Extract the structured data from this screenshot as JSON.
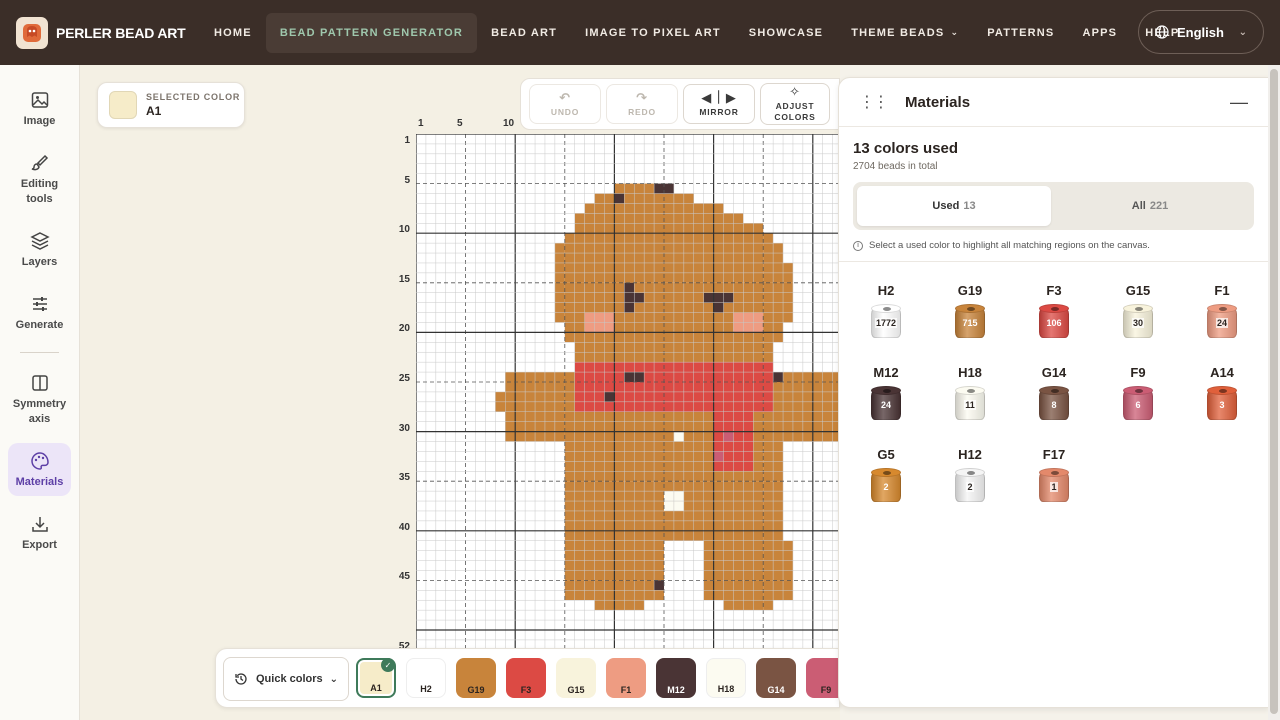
{
  "app": {
    "name": "PERLER BEAD ART"
  },
  "nav": {
    "items": [
      {
        "label": "HOME",
        "active": false
      },
      {
        "label": "BEAD PATTERN GENERATOR",
        "active": true
      },
      {
        "label": "BEAD ART",
        "active": false
      },
      {
        "label": "IMAGE TO PIXEL ART",
        "active": false
      },
      {
        "label": "SHOWCASE",
        "active": false
      },
      {
        "label": "THEME BEADS",
        "active": false,
        "dropdown": true
      },
      {
        "label": "PATTERNS",
        "active": false
      },
      {
        "label": "APPS",
        "active": false
      },
      {
        "label": "HELP",
        "active": false
      }
    ],
    "language": "English"
  },
  "sidebar": {
    "items": [
      {
        "label": "Image",
        "icon": "image-icon"
      },
      {
        "label": "Editing tools",
        "icon": "brush-icon"
      },
      {
        "label": "Layers",
        "icon": "layers-icon"
      },
      {
        "label": "Generate",
        "icon": "sliders-icon"
      },
      {
        "label": "Symmetry axis",
        "icon": "symmetry-icon"
      },
      {
        "label": "Materials",
        "icon": "palette-icon",
        "active": true
      },
      {
        "label": "Export",
        "icon": "download-icon"
      }
    ]
  },
  "selected_color": {
    "caption": "SELECTED COLOR",
    "value": "A1",
    "hex": "#f6ecc9"
  },
  "toolbar": {
    "undo": "UNDO",
    "redo": "REDO",
    "mirror": "MIRROR",
    "adjust": "ADJUST COLORS"
  },
  "rulers": {
    "top": [
      "1",
      "5",
      "10"
    ],
    "left": [
      "1",
      "5",
      "10",
      "15",
      "20",
      "25",
      "30",
      "35",
      "40",
      "45",
      "52"
    ]
  },
  "quick_colors": {
    "label": "Quick colors",
    "swatches": [
      {
        "code": "A1",
        "hex": "#f6ecc9",
        "text": "#2b2420",
        "selected": true
      },
      {
        "code": "H2",
        "hex": "#ffffff",
        "text": "#2b2420"
      },
      {
        "code": "G19",
        "hex": "#c8843b",
        "text": "#2b2420"
      },
      {
        "code": "F3",
        "hex": "#dc4a44",
        "text": "#2b2420"
      },
      {
        "code": "G15",
        "hex": "#f8f3dc",
        "text": "#2b2420"
      },
      {
        "code": "F1",
        "hex": "#ee9c82",
        "text": "#2b2420"
      },
      {
        "code": "M12",
        "hex": "#4a3435",
        "text": "#ffffff"
      },
      {
        "code": "H18",
        "hex": "#fcfbf1",
        "text": "#2b2420"
      },
      {
        "code": "G14",
        "hex": "#7a5443",
        "text": "#ffffff"
      },
      {
        "code": "F9",
        "hex": "#cb5d74",
        "text": "#2b2420"
      }
    ]
  },
  "materials": {
    "title": "Materials",
    "colors_used": "13 colors used",
    "beads_total": "2704 beads in total",
    "tabs": [
      {
        "label": "Used",
        "count": "13",
        "active": true
      },
      {
        "label": "All",
        "count": "221",
        "active": false
      }
    ],
    "hint": "Select a used color to highlight all matching regions on the canvas.",
    "items": [
      {
        "code": "H2",
        "count": "1772",
        "hex": "#ffffff",
        "text": "#2b2420"
      },
      {
        "code": "G19",
        "count": "715",
        "hex": "#c8843b",
        "text": "#ffffff"
      },
      {
        "code": "F3",
        "count": "106",
        "hex": "#dc4a44",
        "text": "#ffffff"
      },
      {
        "code": "G15",
        "count": "30",
        "hex": "#f8f3dc",
        "text": "#2b2420"
      },
      {
        "code": "F1",
        "count": "24",
        "hex": "#ee9c82",
        "text": "#2b2420"
      },
      {
        "code": "M12",
        "count": "24",
        "hex": "#4a3435",
        "text": "#ffffff"
      },
      {
        "code": "H18",
        "count": "11",
        "hex": "#fcfbf1",
        "text": "#2b2420"
      },
      {
        "code": "G14",
        "count": "8",
        "hex": "#7a5443",
        "text": "#ffffff"
      },
      {
        "code": "F9",
        "count": "6",
        "hex": "#cb5d74",
        "text": "#ffffff"
      },
      {
        "code": "A14",
        "count": "3",
        "hex": "#e0603b",
        "text": "#ffffff"
      },
      {
        "code": "G5",
        "count": "2",
        "hex": "#d7892e",
        "text": "#ffffff"
      },
      {
        "code": "H12",
        "count": "2",
        "hex": "#f5f5f5",
        "text": "#2b2420"
      },
      {
        "code": "F17",
        "count": "1",
        "hex": "#e4896b",
        "text": "#2b2420"
      }
    ]
  },
  "colors": {
    "topbar": "#3b2e28",
    "accent_green": "#3e7a5a",
    "accent_purple": "#5d3fa6"
  }
}
